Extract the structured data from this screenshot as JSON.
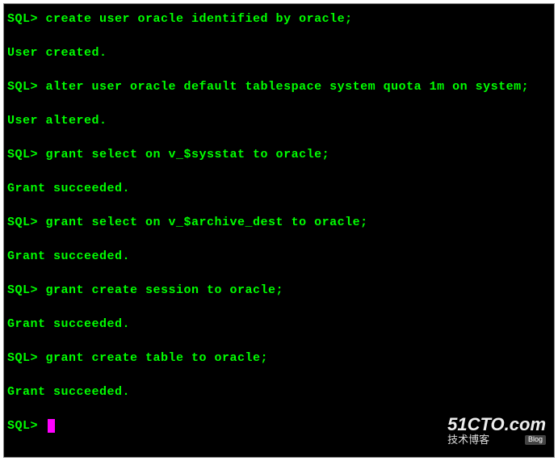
{
  "terminal": {
    "lines": [
      {
        "type": "cmd",
        "prompt": "SQL>",
        "text": " create user oracle identified by oracle;"
      },
      {
        "type": "blank"
      },
      {
        "type": "out",
        "text": "User created."
      },
      {
        "type": "blank"
      },
      {
        "type": "cmd",
        "prompt": "SQL>",
        "text": " alter user oracle default tablespace system quota 1m on system;"
      },
      {
        "type": "blank"
      },
      {
        "type": "out",
        "text": "User altered."
      },
      {
        "type": "blank"
      },
      {
        "type": "cmd",
        "prompt": "SQL>",
        "text": " grant select on v_$sysstat to oracle;"
      },
      {
        "type": "blank"
      },
      {
        "type": "out",
        "text": "Grant succeeded."
      },
      {
        "type": "blank"
      },
      {
        "type": "cmd",
        "prompt": "SQL>",
        "text": " grant select on v_$archive_dest to oracle;"
      },
      {
        "type": "blank"
      },
      {
        "type": "out",
        "text": "Grant succeeded."
      },
      {
        "type": "blank"
      },
      {
        "type": "cmd",
        "prompt": "SQL>",
        "text": " grant create session to oracle;"
      },
      {
        "type": "blank"
      },
      {
        "type": "out",
        "text": "Grant succeeded."
      },
      {
        "type": "blank"
      },
      {
        "type": "cmd",
        "prompt": "SQL>",
        "text": " grant create table to oracle;"
      },
      {
        "type": "blank"
      },
      {
        "type": "out",
        "text": "Grant succeeded."
      },
      {
        "type": "blank"
      },
      {
        "type": "cursor",
        "prompt": "SQL>"
      }
    ]
  },
  "watermark": {
    "top": "51CTO.com",
    "bottom": "技术博客",
    "badge": "Blog"
  }
}
